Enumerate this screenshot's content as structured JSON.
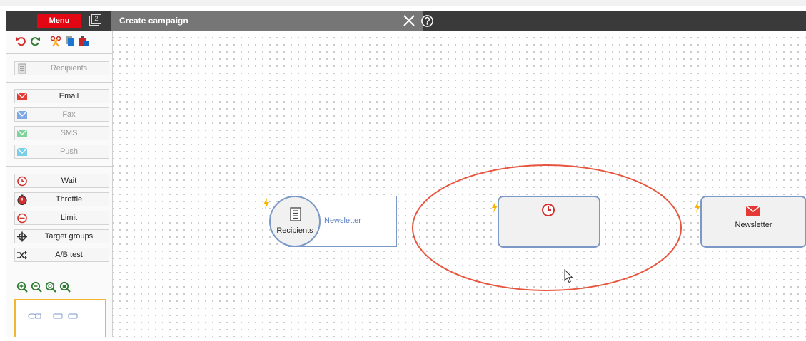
{
  "topbar": {
    "menu_label": "Menu",
    "window_count": "2",
    "tab_title": "Create campaign"
  },
  "sidebar": {
    "recipients_item": {
      "label": "Recipients",
      "icon": "document-list-icon"
    },
    "channels": [
      {
        "label": "Email",
        "icon": "envelope-icon",
        "enabled": true,
        "color": "#e53935"
      },
      {
        "label": "Fax",
        "icon": "envelope-icon",
        "enabled": false,
        "color": "#7ea8e8"
      },
      {
        "label": "SMS",
        "icon": "envelope-icon",
        "enabled": false,
        "color": "#7fd39a"
      },
      {
        "label": "Push",
        "icon": "envelope-icon",
        "enabled": false,
        "color": "#79cfe8"
      }
    ],
    "controls": [
      {
        "label": "Wait",
        "icon": "clock-icon"
      },
      {
        "label": "Throttle",
        "icon": "stopwatch-icon"
      },
      {
        "label": "Limit",
        "icon": "minus-circle-icon"
      },
      {
        "label": "Target groups",
        "icon": "crosshair-icon"
      },
      {
        "label": "A/B test",
        "icon": "shuffle-icon"
      }
    ]
  },
  "canvas": {
    "nodes": {
      "recipients": {
        "circle_label": "Recipients",
        "side_label": "Newsletter"
      },
      "wait": {
        "icon": "clock-icon"
      },
      "email": {
        "label": "Newsletter",
        "icon": "envelope-icon"
      }
    },
    "highlight_color": "#e8553e",
    "node_border_color": "#7b98c6",
    "accent": "#e30613"
  }
}
